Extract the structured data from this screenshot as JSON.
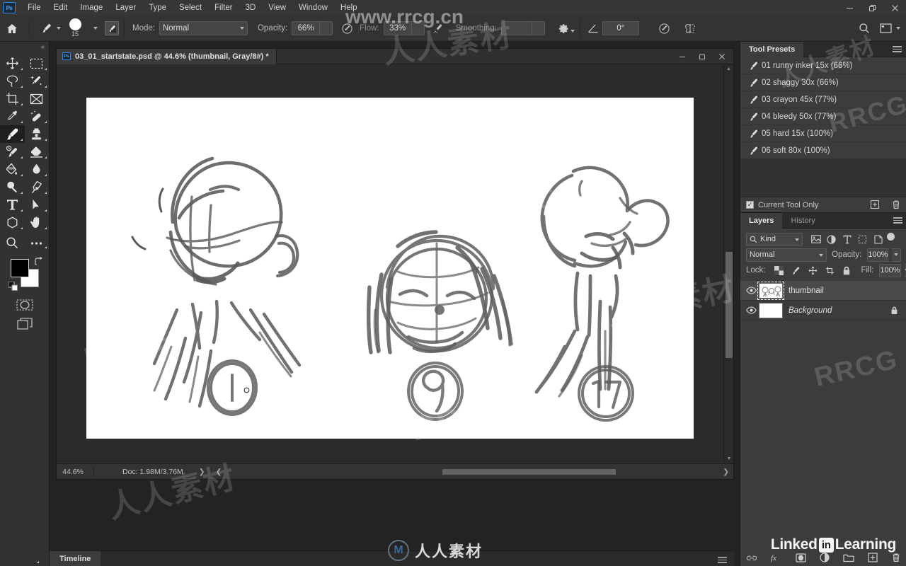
{
  "app": {
    "name": "Adobe Photoshop",
    "logo_text": "Ps"
  },
  "menubar": {
    "items": [
      "File",
      "Edit",
      "Image",
      "Layer",
      "Type",
      "Select",
      "Filter",
      "3D",
      "View",
      "Window",
      "Help"
    ],
    "window_controls": {
      "minimize": "—",
      "maximize": "❐",
      "close": "✕"
    }
  },
  "options_bar": {
    "home_icon": "home-icon",
    "brush_preset_icon": "brush-icon",
    "brush_size": "15",
    "brush_panel_icon": "brush-panel-icon",
    "mode_label": "Mode:",
    "mode_value": "Normal",
    "opacity_label": "Opacity:",
    "opacity_value": "66%",
    "pressure_opacity_icon": "pressure-opacity-icon",
    "flow_label": "Flow:",
    "flow_value": "33%",
    "airbrush_icon": "airbrush-icon",
    "smoothing_label": "Smoothing:",
    "smoothing_value": "",
    "smoothing_options_icon": "gear-icon",
    "angle_icon": "angle-icon",
    "angle_value": "0°",
    "pressure_size_icon": "pressure-size-icon",
    "symmetry_icon": "symmetry-butterfly-icon",
    "search_icon": "search-icon",
    "workspace_icon": "workspace-icon"
  },
  "toolbar": {
    "collapse_label": "«",
    "tools": [
      {
        "name": "move-tool",
        "glyph": "move"
      },
      {
        "name": "rectangular-marquee-tool",
        "glyph": "marquee"
      },
      {
        "name": "lasso-tool",
        "glyph": "lasso"
      },
      {
        "name": "quick-selection-tool",
        "glyph": "wand"
      },
      {
        "name": "crop-tool",
        "glyph": "crop"
      },
      {
        "name": "frame-tool",
        "glyph": "frame"
      },
      {
        "name": "eyedropper-tool",
        "glyph": "eyedropper"
      },
      {
        "name": "spot-healing-brush-tool",
        "glyph": "healing"
      },
      {
        "name": "brush-tool",
        "glyph": "brush",
        "active": true
      },
      {
        "name": "clone-stamp-tool",
        "glyph": "stamp"
      },
      {
        "name": "history-brush-tool",
        "glyph": "historybrush"
      },
      {
        "name": "eraser-tool",
        "glyph": "eraser"
      },
      {
        "name": "gradient-tool",
        "glyph": "bucket"
      },
      {
        "name": "blur-tool",
        "glyph": "blur"
      },
      {
        "name": "dodge-tool",
        "glyph": "dodge"
      },
      {
        "name": "pen-tool",
        "glyph": "pen"
      },
      {
        "name": "horizontal-type-tool",
        "glyph": "type"
      },
      {
        "name": "path-selection-tool",
        "glyph": "arrow"
      },
      {
        "name": "shape-tool",
        "glyph": "polygon"
      },
      {
        "name": "hand-tool",
        "glyph": "hand"
      },
      {
        "name": "zoom-tool",
        "glyph": "zoom"
      },
      {
        "name": "edit-toolbar-tool",
        "glyph": "ellipsis"
      }
    ],
    "foreground_color": "#000000",
    "background_color": "#ffffff",
    "quick_mask_icon": "quick-mask-icon",
    "screen_mode_icon": "screen-mode-icon"
  },
  "document": {
    "tab_title": "03_01_startstate.psd @ 44.6% (thumbnail, Gray/8#) *",
    "window_controls": {
      "minimize": "—",
      "maximize": "▫",
      "close": "✕"
    },
    "status_zoom": "44.6%",
    "status_doc": "Doc: 1.98M/3.76M",
    "artwork_labels": [
      "1",
      "9",
      "17"
    ]
  },
  "tool_presets": {
    "tab_label": "Tool Presets",
    "items": [
      "01 runny inker 15x (66%)",
      "02 shaggy 30x (66%)",
      "03 crayon 45x (77%)",
      "04 bleedy 50x (77%)",
      "05 hard 15x (100%)",
      "06 soft 80x (100%)"
    ],
    "current_tool_only_label": "Current Tool Only",
    "current_tool_only_checked": true,
    "new_preset_icon": "new-preset-icon",
    "delete_preset_icon": "trash-icon"
  },
  "layers_panel": {
    "tabs": [
      "Layers",
      "History"
    ],
    "active_tab": "Layers",
    "filter_label": "Kind",
    "filter_icons": [
      "pixel-filter-icon",
      "adjustment-filter-icon",
      "type-filter-icon",
      "shape-filter-icon",
      "smart-object-filter-icon"
    ],
    "blend_mode": "Normal",
    "opacity_label": "Opacity:",
    "opacity_value": "100%",
    "lock_label": "Lock:",
    "lock_icons": [
      "lock-transparent-pixels-icon",
      "lock-image-pixels-icon",
      "lock-position-icon",
      "lock-artboard-icon",
      "lock-all-icon"
    ],
    "fill_label": "Fill:",
    "fill_value": "100%",
    "layers": [
      {
        "name": "thumbnail",
        "visible": true,
        "selected": true,
        "italic": false,
        "locked": false
      },
      {
        "name": "Background",
        "visible": true,
        "selected": false,
        "italic": true,
        "locked": true
      }
    ],
    "footer_icons": [
      "link-layers-icon",
      "layer-style-fx-icon",
      "layer-mask-icon",
      "adjustment-layer-icon",
      "new-group-icon",
      "new-layer-icon",
      "delete-layer-icon"
    ]
  },
  "timeline": {
    "tab_label": "Timeline",
    "menu_icon": "panel-menu-icon"
  },
  "watermarks": {
    "site_url": "www.rrcg.cn",
    "brand_cn": "人人素材",
    "brand_latin": "RRCG",
    "linkedin": {
      "prefix": "Linked",
      "badge": "in",
      "suffix": "Learning"
    }
  },
  "colors": {
    "menubar_bg": "#363636",
    "options_bg": "#333333",
    "panel_bg": "#3c3c3c",
    "toolbar_bg": "#323232",
    "canvas_bg": "#2b2b2b",
    "accent_blue": "#2d8ceb",
    "text": "#c8c8c8"
  }
}
